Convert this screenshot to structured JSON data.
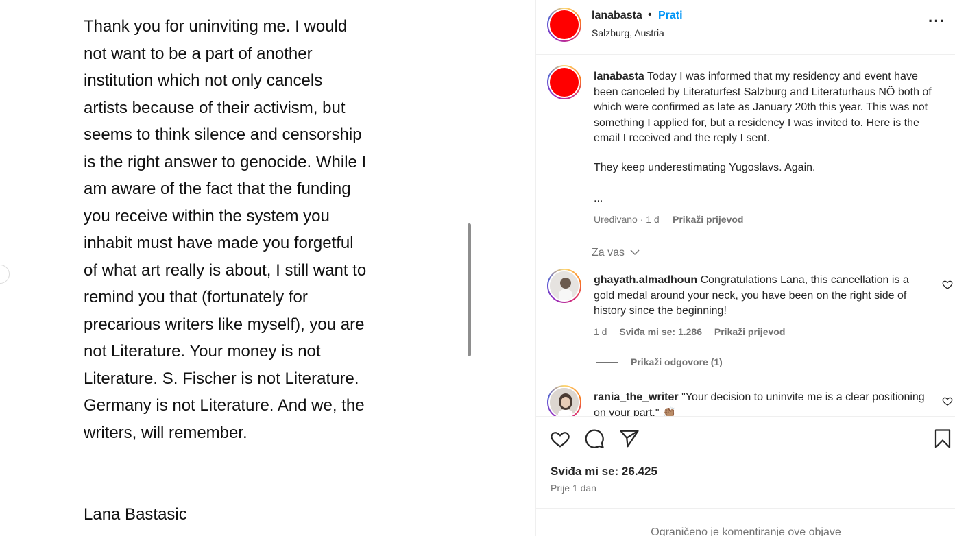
{
  "image": {
    "letter_lines": [
      "Thank you for uninviting me. I would",
      "not want to be a part of another",
      "institution which not only cancels",
      "artists because of their activism, but",
      "seems to think silence and censorship",
      "is the right answer to genocide. While I",
      "am aware of the fact that the funding",
      "you receive within the system you",
      "inhabit must have made you forgetful",
      "of what art really is about, I still want to",
      "remind you that (fortunately for",
      "precarious writers like myself), you are",
      "not Literature. Your money is not",
      "Literature. S. Fischer is not Literature.",
      "Germany is not Literature. And we, the",
      "writers, will remember."
    ],
    "signature": "Lana Bastasic"
  },
  "header": {
    "username": "lanabasta",
    "dot": "•",
    "follow_label": "Prati",
    "location": "Salzburg, Austria",
    "more_label": "···"
  },
  "caption": {
    "username": "lanabasta",
    "text": "Today I was informed that my residency and event have been canceled by Literaturfest Salzburg and Literaturhaus NÖ both of which were confirmed as late as January 20th this year. This was not something I applied for, but a residency I was invited to. Here is the email I received and the reply I sent.",
    "paragraph2": "They keep underestimating Yugoslavs. Again.",
    "ellipsis": "...",
    "meta": "Uređivano · 1 d",
    "translate_label": "Prikaži prijevod"
  },
  "for_you_label": "Za vas",
  "comments": [
    {
      "username": "ghayath.almadhoun",
      "text": "Congratulations Lana, this cancellation is a gold medal around your neck, you have been on the right side of history since the beginning!",
      "time": "1 d",
      "likes": "Sviđa mi se: 1.286",
      "translate_label": "Prikaži prijevod",
      "replies_label": "Prikaži odgovore (1)"
    },
    {
      "username": "rania_the_writer",
      "text": "\"Your decision to uninvite me is a clear positioning on your part.\" 👏🏽"
    }
  ],
  "actions": {
    "likes_count": "Sviđa mi se: 26.425",
    "post_time": "Prije 1 dan",
    "comments_limited": "Ograničeno je komentiranje ove objave"
  },
  "colors": {
    "link_blue": "#0095f6",
    "muted_text": "#737373",
    "avatar_red": "#ff0000"
  }
}
